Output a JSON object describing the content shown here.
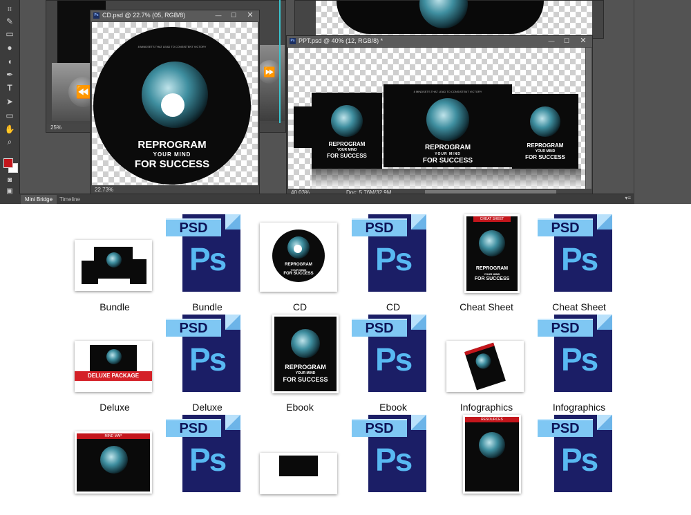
{
  "photoshop": {
    "bottom_tabs": [
      "Mini Bridge",
      "Timeline"
    ],
    "windows": {
      "back_left": {
        "zoom": "25%"
      },
      "cd": {
        "title": "CD.psd @ 22.7% (05, RGB/8)",
        "zoom": "22.73%",
        "tagline": "8 MINDSETS THAT LEAD TO CONSISTENT VICTORY",
        "line1": "REPROGRAM",
        "line2": "YOUR MIND",
        "line3": "FOR SUCCESS"
      },
      "ppt": {
        "title": "PPT.psd @ 40% (12, RGB/8) *",
        "zoom": "40.03%",
        "doc": "Doc: 5.76M/32.9M",
        "tagline": "8 MINDSETS THAT LEAD TO CONSISTENT VICTORY",
        "line1": "REPROGRAM",
        "line2": "YOUR MIND",
        "line3": "FOR SUCCESS"
      }
    },
    "psd_badge": "Ps",
    "colors": {
      "foreground": "#c4161c",
      "background": "#ffffff"
    }
  },
  "explorer": {
    "psd_tag": "PSD",
    "psd_letters": "Ps",
    "deluxe_ribbon": "DELUXE PACKAGE",
    "cheat_header": "CHEAT SHEET",
    "mindmap_header": "MIND MAP",
    "resources_header": "RESOURCES",
    "product_line1": "REPROGRAM",
    "product_line2": "YOUR MIND",
    "product_line3": "FOR SUCCESS",
    "files": [
      {
        "label": "Bundle",
        "kind": "image"
      },
      {
        "label": "Bundle",
        "kind": "psd"
      },
      {
        "label": "CD",
        "kind": "image"
      },
      {
        "label": "CD",
        "kind": "psd"
      },
      {
        "label": "Cheat Sheet",
        "kind": "image"
      },
      {
        "label": "Cheat Sheet",
        "kind": "psd"
      },
      {
        "label": "Deluxe",
        "kind": "image"
      },
      {
        "label": "Deluxe",
        "kind": "psd"
      },
      {
        "label": "Ebook",
        "kind": "image"
      },
      {
        "label": "Ebook",
        "kind": "psd"
      },
      {
        "label": "Infographics",
        "kind": "image"
      },
      {
        "label": "Infographics",
        "kind": "psd"
      }
    ]
  }
}
